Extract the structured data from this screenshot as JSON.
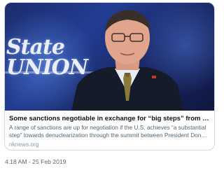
{
  "card": {
    "headline": "Some sanctions negotiable in exchange for “big steps” from N. Korea: Pomp…",
    "description": "A range of sanctions are up for negotiation if the U.S. achieves “a substantial step” towards denuclearization through the summit between President Donald Trump an…",
    "domain": "nknews.org",
    "image": {
      "brand_line1": "State",
      "brand_line2": "UNION"
    }
  },
  "timestamp": "4:18 AM - 25 Feb 2019"
}
